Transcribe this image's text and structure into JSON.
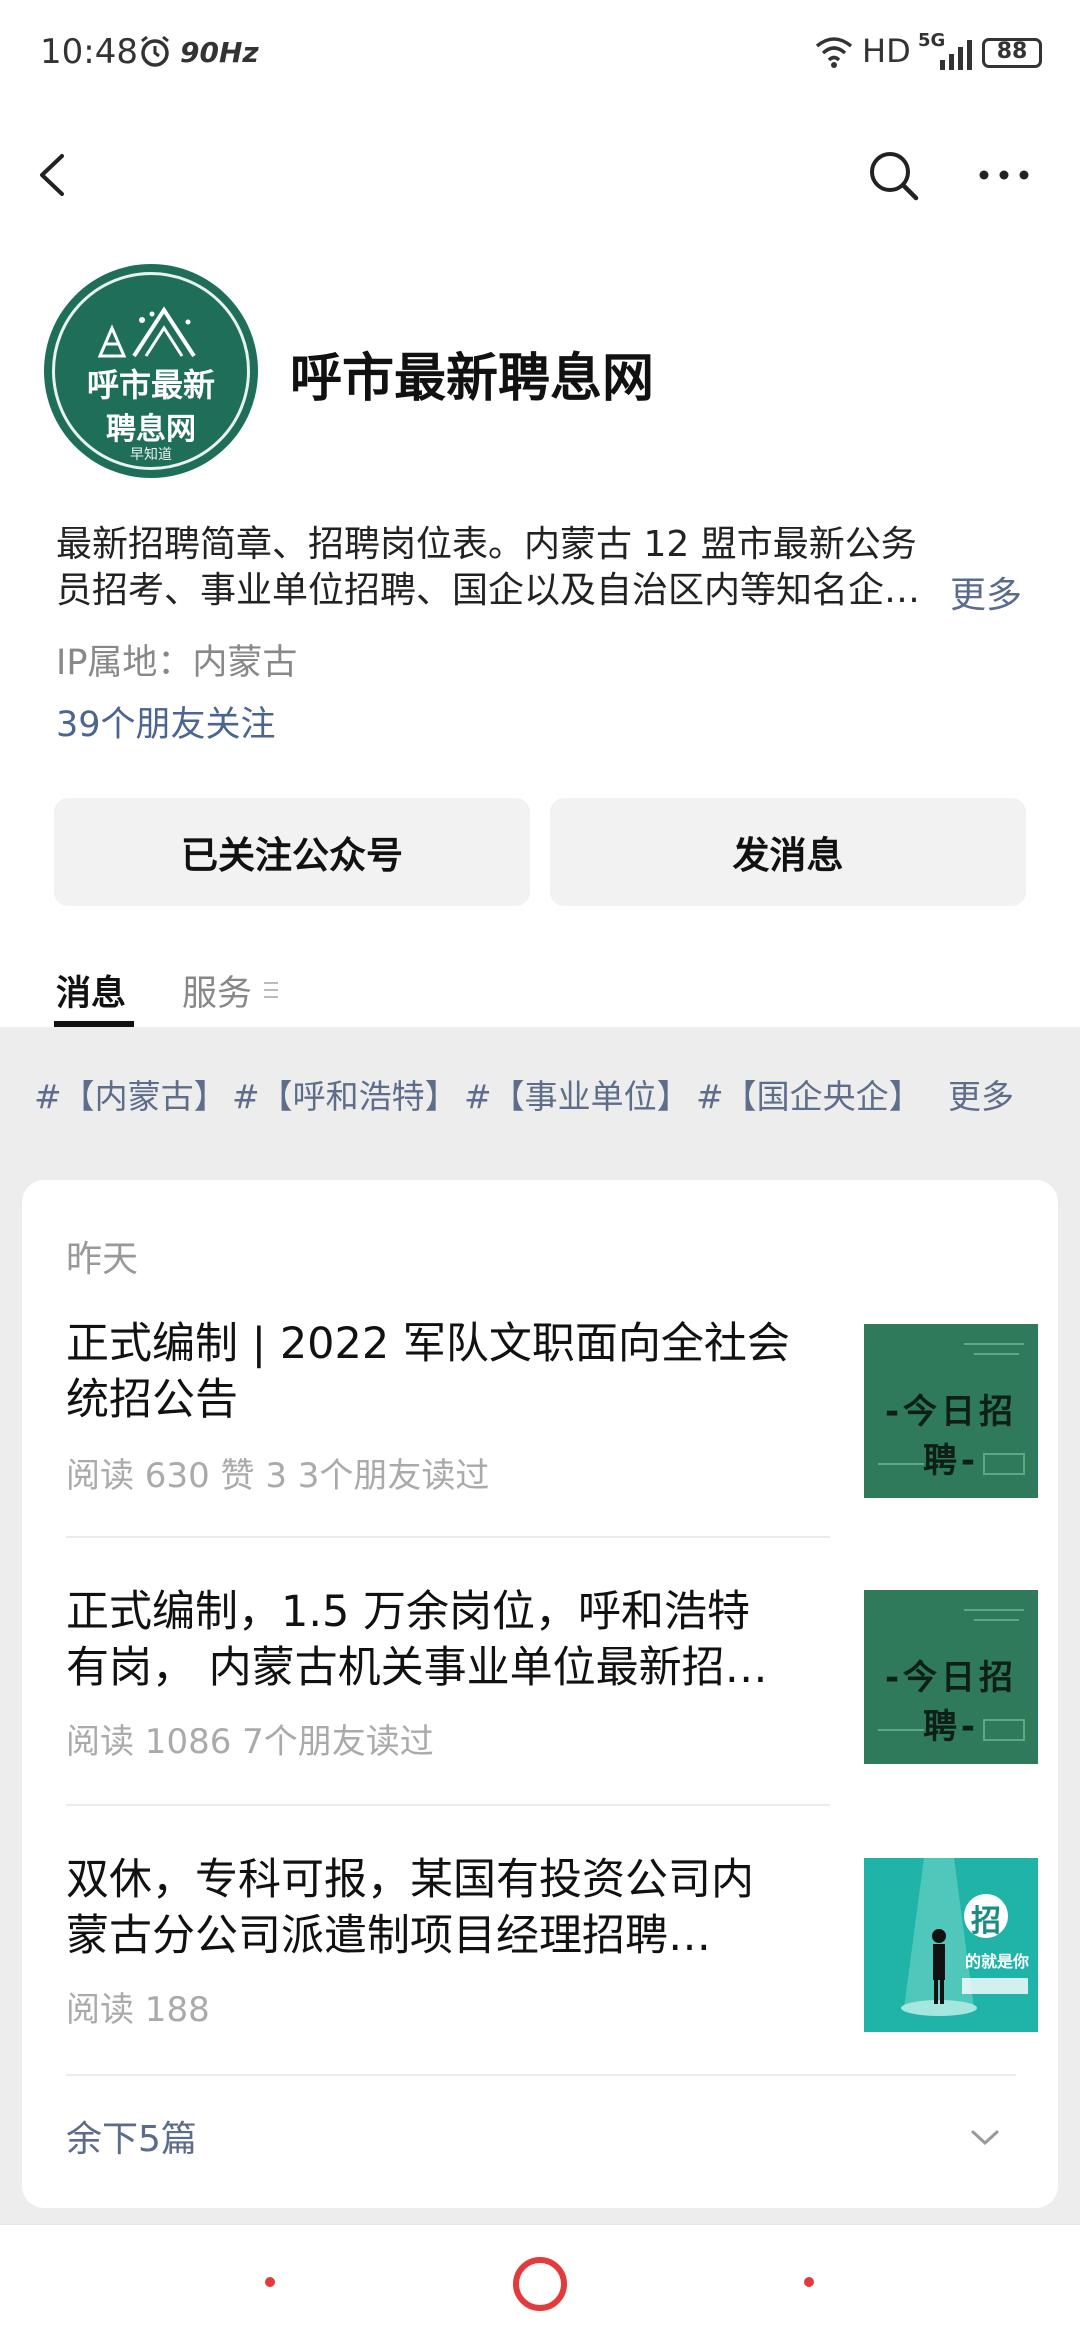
{
  "status_bar": {
    "time": "10:48",
    "refresh_rate": "90Hz",
    "hd": "HD",
    "network": "5G",
    "battery": "88"
  },
  "account": {
    "name": "呼市最新聘息网",
    "logo_line1": "呼市最新",
    "logo_line2": "聘息网",
    "logo_line3": "早知道",
    "description_line1": "最新招聘简章、招聘岗位表。内蒙古 12 盟市最新公务",
    "description_line2": "员招考、事业单位招聘、国企以及自治区内等知名企…",
    "description_more": "更多",
    "ip_location": "IP属地：内蒙古",
    "friends_following": "39个朋友关注"
  },
  "buttons": {
    "followed": "已关注公众号",
    "send_message": "发消息"
  },
  "tabs": [
    {
      "label": "消息",
      "active": true
    },
    {
      "label": "服务",
      "active": false
    }
  ],
  "tags": {
    "items": [
      "#【内蒙古】",
      "#【呼和浩特】",
      "#【事业单位】",
      "#【国企央企】"
    ],
    "more": "更多"
  },
  "feed": {
    "date_label": "昨天",
    "articles": [
      {
        "title_line1": "正式编制 | 2022 军队文职面向全社会",
        "title_line2": "统招公告",
        "meta": "阅读 630   赞 3   3个朋友读过",
        "thumb_text": "-今日招聘-"
      },
      {
        "title_line1": "正式编制，1.5 万余岗位，呼和浩特",
        "title_line2": "有岗， 内蒙古机关事业单位最新招…",
        "meta": "阅读 1086   7个朋友读过",
        "thumb_text": "-今日招聘-"
      },
      {
        "title_line1": "双休，专科可报，某国有投资公司内",
        "title_line2": "蒙古分公司派遣制项目经理招聘…",
        "meta": "阅读 188",
        "thumb_text": "招",
        "thumb_subtext": "的就是你"
      }
    ],
    "remaining": "余下5篇"
  },
  "colors": {
    "link_blue": "#5b6b8c",
    "logo_green": "#1f6e5a",
    "thumb_teal": "#1fb4a7",
    "nav_red": "#e23b3b"
  }
}
